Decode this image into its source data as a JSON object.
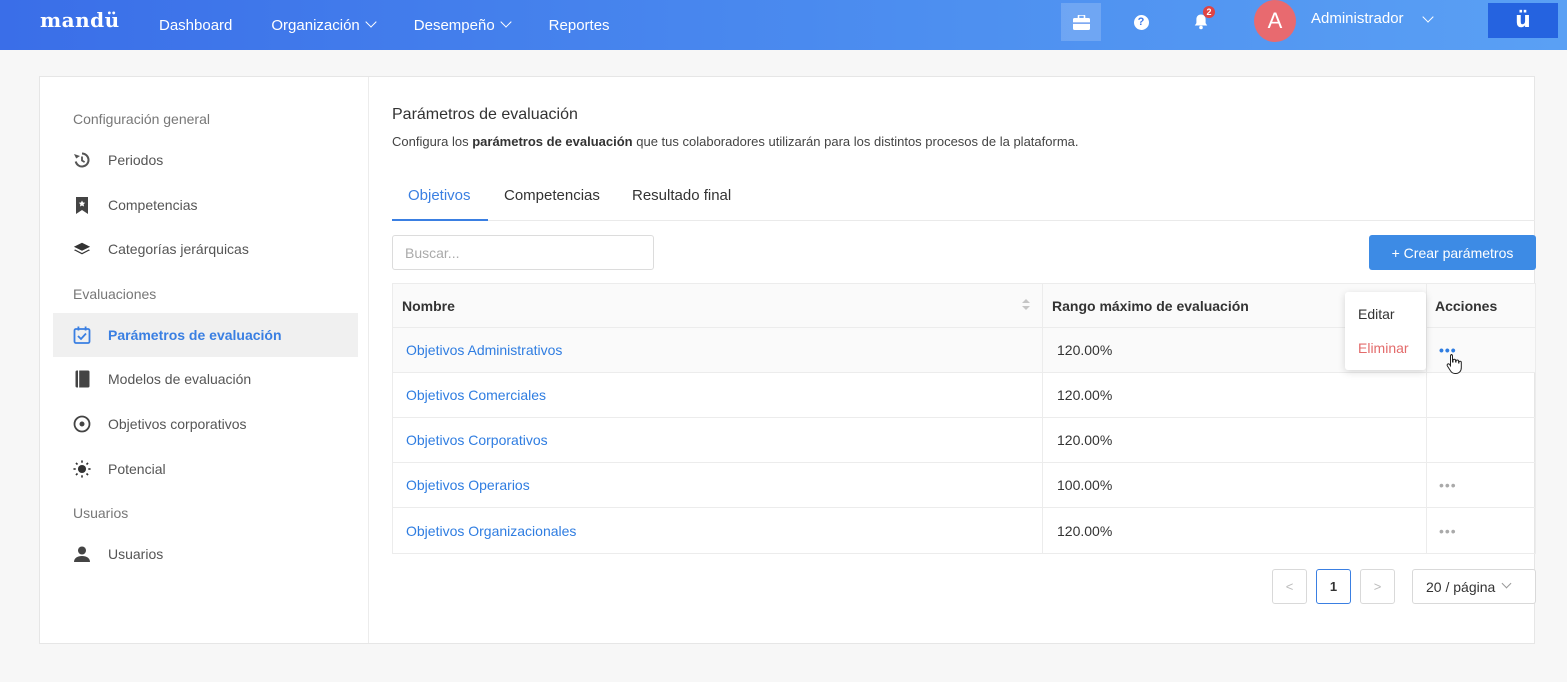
{
  "topbar": {
    "brand": "mandü",
    "nav": [
      {
        "label": "Dashboard",
        "has_menu": false
      },
      {
        "label": "Organización",
        "has_menu": true
      },
      {
        "label": "Desempeño",
        "has_menu": true
      },
      {
        "label": "Reportes",
        "has_menu": false
      }
    ],
    "notification_count": "2",
    "avatar_initial": "A",
    "user_name": "Administrador",
    "app_logo": "ü",
    "colors": {
      "bar": "#3a6ee8",
      "avatar": "#e86a6f"
    }
  },
  "sidebar": {
    "section_general": "Configuración general",
    "section_evaluations": "Evaluaciones",
    "section_users": "Usuarios",
    "items": [
      {
        "label": "Periodos",
        "icon": "history-icon"
      },
      {
        "label": "Competencias",
        "icon": "bookmark-icon"
      },
      {
        "label": "Categorías jerárquicas",
        "icon": "layers-icon"
      },
      {
        "label": "Parámetros de evaluación",
        "icon": "checkbox-calendar-icon",
        "active": true
      },
      {
        "label": "Modelos de evaluación",
        "icon": "book-icon"
      },
      {
        "label": "Objetivos corporativos",
        "icon": "target-icon"
      },
      {
        "label": "Potencial",
        "icon": "lightbulb-icon"
      },
      {
        "label": "Usuarios",
        "icon": "user-icon"
      }
    ]
  },
  "main": {
    "title": "Parámetros de evaluación",
    "desc_before": "Configura los ",
    "desc_bold": "parámetros de evaluación",
    "desc_after": " que tus colaboradores utilizarán para los distintos procesos de la plataforma.",
    "tabs": [
      {
        "label": "Objetivos",
        "active": true
      },
      {
        "label": "Competencias"
      },
      {
        "label": "Resultado final"
      }
    ],
    "search_placeholder": "Buscar...",
    "create_label": "+ Crear parámetros",
    "columns": [
      "Nombre",
      "Rango máximo de evaluación",
      "Acciones"
    ],
    "rows": [
      {
        "name": "Objetivos Administrativos",
        "range": "120.00%"
      },
      {
        "name": "Objetivos Comerciales",
        "range": "120.00%"
      },
      {
        "name": "Objetivos Corporativos",
        "range": "120.00%"
      },
      {
        "name": "Objetivos Operarios",
        "range": "100.00%"
      },
      {
        "name": "Objetivos Organizacionales",
        "range": "120.00%"
      }
    ],
    "action_dots": "•••",
    "menu": {
      "edit": "Editar",
      "delete": "Eliminar"
    },
    "pagination": {
      "prev": "<",
      "page": "1",
      "next": ">",
      "page_size": "20 / página"
    },
    "accent_color": "#3a7fe2"
  }
}
